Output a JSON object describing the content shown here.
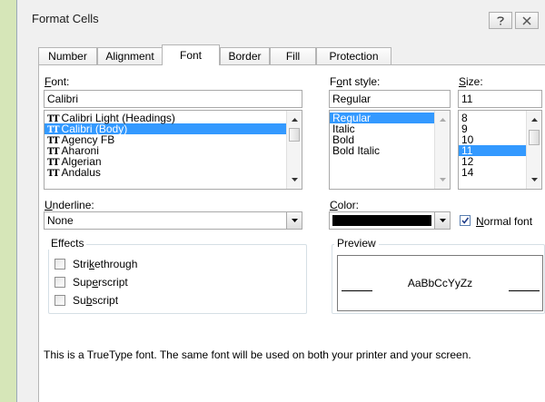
{
  "window": {
    "title": "Format Cells"
  },
  "tabs": [
    {
      "label": "Number"
    },
    {
      "label": "Alignment"
    },
    {
      "label": "Font"
    },
    {
      "label": "Border"
    },
    {
      "label": "Fill"
    },
    {
      "label": "Protection"
    }
  ],
  "active_tab": "Font",
  "font": {
    "label_u": "F",
    "label_rest": "ont:",
    "value": "Calibri",
    "list": [
      {
        "label": "Calibri Light (Headings)",
        "selected": false
      },
      {
        "label": "Calibri (Body)",
        "selected": true
      },
      {
        "label": "Agency FB",
        "selected": false
      },
      {
        "label": "Aharoni",
        "selected": false
      },
      {
        "label": "Algerian",
        "selected": false
      },
      {
        "label": "Andalus",
        "selected": false
      }
    ],
    "icon": "truetype-icon"
  },
  "font_style": {
    "label_pre": "F",
    "label_u": "o",
    "label_rest": "nt style:",
    "value": "Regular",
    "list": [
      {
        "label": "Regular",
        "selected": true
      },
      {
        "label": "Italic",
        "selected": false
      },
      {
        "label": "Bold",
        "selected": false
      },
      {
        "label": "Bold Italic",
        "selected": false
      }
    ]
  },
  "size": {
    "label_u": "S",
    "label_rest": "ize:",
    "value": "11",
    "list": [
      {
        "label": "8",
        "selected": false
      },
      {
        "label": "9",
        "selected": false
      },
      {
        "label": "10",
        "selected": false
      },
      {
        "label": "11",
        "selected": true
      },
      {
        "label": "12",
        "selected": false
      },
      {
        "label": "14",
        "selected": false
      }
    ]
  },
  "underline": {
    "label_u": "U",
    "label_rest": "nderline:",
    "value": "None"
  },
  "color": {
    "label_u": "C",
    "label_rest": "olor:",
    "value": "#000000",
    "normal_font_u": "N",
    "normal_font_rest": "ormal font",
    "normal_font_checked": true
  },
  "effects": {
    "title": "Effects",
    "items": [
      {
        "pre": "Stri",
        "u": "k",
        "rest": "ethrough",
        "checked": false
      },
      {
        "pre": "Sup",
        "u": "e",
        "rest": "rscript",
        "checked": false
      },
      {
        "pre": "Su",
        "u": "b",
        "rest": "script",
        "checked": false
      }
    ]
  },
  "preview": {
    "title": "Preview",
    "sample": "AaBbCcYyZz"
  },
  "info_text": "This is a TrueType font.  The same font will be used on both your printer and your screen."
}
